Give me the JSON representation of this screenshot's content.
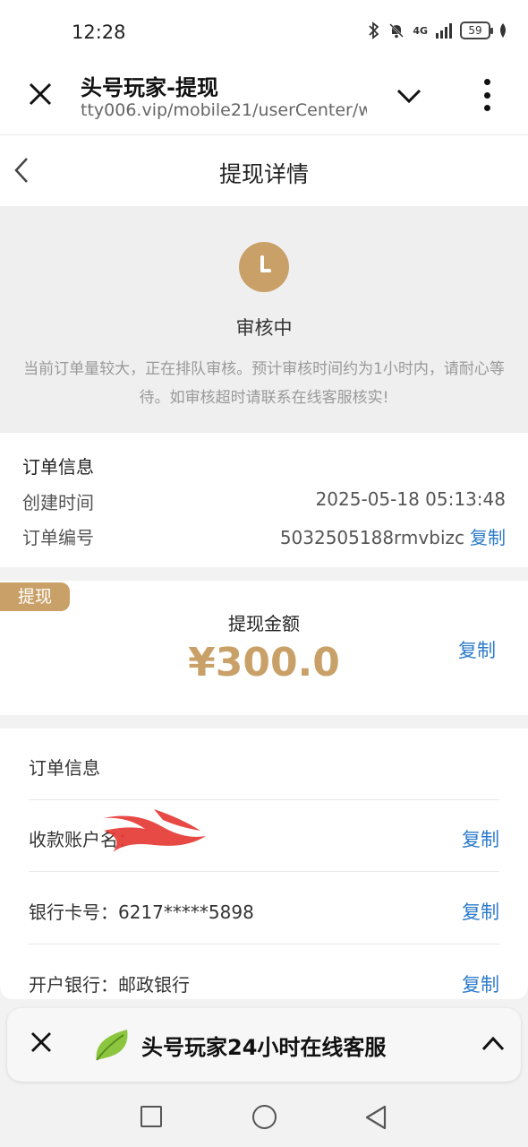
{
  "status_bar": {
    "time": "12:28",
    "network": "4G",
    "battery": "59"
  },
  "browser": {
    "title": "头号玩家-提现",
    "url": "tty006.vip/mobile21/userCenter/wi"
  },
  "header": {
    "title": "提现详情"
  },
  "review": {
    "status": "审核中",
    "description": "当前订单量较大，正在排队审核。预计审核时间约为1小时内，请耐心等待。如审核超时请联系在线客服核实!"
  },
  "order": {
    "heading": "订单信息",
    "created_label": "创建时间",
    "created_value": "2025-05-18 05:13:48",
    "number_label": "订单编号",
    "number_value": "5032505188rmvbizc",
    "copy_label": "复制"
  },
  "amount": {
    "tag": "提现",
    "label": "提现金额",
    "value": "¥300.0",
    "copy_label": "复制"
  },
  "account": {
    "heading": "订单信息",
    "rows": [
      {
        "label": "收款账户名：",
        "copy": "复制"
      },
      {
        "label": "银行卡号：6217*****5898",
        "copy": "复制"
      },
      {
        "label": "开户银行：邮政银行",
        "copy": "复制"
      }
    ]
  },
  "service": {
    "title": "头号玩家24小时在线客服"
  },
  "colors": {
    "accent_gold": "#c9a168",
    "link_blue": "#2b7bc9"
  }
}
